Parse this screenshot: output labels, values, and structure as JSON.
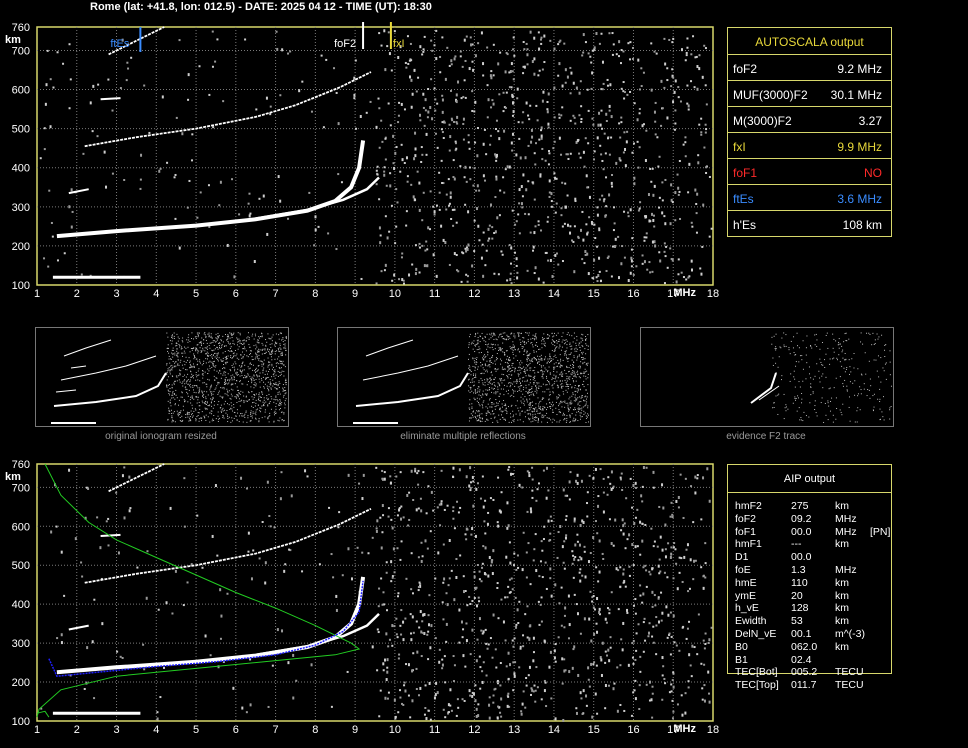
{
  "header": "Rome (lat: +41.8, lon: 012.5) - DATE: 2025 04 12 - TIME (UT): 18:30",
  "ionogram": {
    "x_ticks": [
      "1",
      "2",
      "3",
      "4",
      "5",
      "6",
      "7",
      "8",
      "9",
      "10",
      "11",
      "12",
      "13",
      "14",
      "15",
      "16",
      "17",
      "18"
    ],
    "x_unit": "MHz",
    "y_ticks": [
      "760",
      "700",
      "600",
      "500",
      "400",
      "300",
      "200",
      "100"
    ],
    "y_unit": "km",
    "marker_ftEs": "ftEs",
    "marker_foF2": "foF2",
    "marker_fxI": "fxI"
  },
  "autoscala": {
    "title": "AUTOSCALA output",
    "rows": [
      {
        "label": "foF2",
        "value": "9.2 MHz",
        "color": "#ffffff"
      },
      {
        "label": "MUF(3000)F2",
        "value": "30.1 MHz",
        "color": "#ffffff"
      },
      {
        "label": "M(3000)F2",
        "value": "3.27",
        "color": "#ffffff"
      },
      {
        "label": "fxI",
        "value": "9.9 MHz",
        "color": "#e8d83a"
      },
      {
        "label": "foF1",
        "value": "NO",
        "color": "#ff2a2a"
      },
      {
        "label": "ftEs",
        "value": "3.6 MHz",
        "color": "#3a8cff"
      },
      {
        "label": "h'Es",
        "value": "108    km",
        "color": "#ffffff"
      }
    ]
  },
  "thumbnails": {
    "captions": [
      "original ionogram resized",
      "eliminate multiple reflections",
      "evidence F2 trace"
    ]
  },
  "aip": {
    "title": "AIP output",
    "rows": [
      {
        "name": "hmF2",
        "value": "275",
        "unit": "km",
        "extra": ""
      },
      {
        "name": "foF2",
        "value": "09.2",
        "unit": "MHz",
        "extra": ""
      },
      {
        "name": "foF1",
        "value": "00.0",
        "unit": "MHz",
        "extra": "[PN]"
      },
      {
        "name": "hmF1",
        "value": "---",
        "unit": "km",
        "extra": ""
      },
      {
        "name": "D1",
        "value": "00.0",
        "unit": "",
        "extra": ""
      },
      {
        "name": "foE",
        "value": "1.3",
        "unit": "MHz",
        "extra": ""
      },
      {
        "name": "hmE",
        "value": "110",
        "unit": "km",
        "extra": ""
      },
      {
        "name": "ymE",
        "value": "20",
        "unit": "km",
        "extra": ""
      },
      {
        "name": "h_vE",
        "value": "128",
        "unit": "km",
        "extra": ""
      },
      {
        "name": "Ewidth",
        "value": "53",
        "unit": "km",
        "extra": ""
      },
      {
        "name": "DelN_vE",
        "value": "00.1",
        "unit": "m^(-3)",
        "extra": ""
      },
      {
        "name": "B0",
        "value": "062.0",
        "unit": "km",
        "extra": ""
      },
      {
        "name": "B1",
        "value": "02.4",
        "unit": "",
        "extra": ""
      },
      {
        "name": "TEC[Bot]",
        "value": "005.2",
        "unit": "TECU",
        "extra": ""
      },
      {
        "name": "TEC[Top]",
        "value": "011.7",
        "unit": "TECU",
        "extra": ""
      }
    ]
  },
  "colors": {
    "frame": "#d7d76b",
    "grid": "#7a7a7a",
    "trace": "#ffffff",
    "ftEs": "#3a8cff",
    "fxI": "#e8d83a",
    "profile_green": "#22cc22",
    "fit_blue": "#2020ff"
  }
}
